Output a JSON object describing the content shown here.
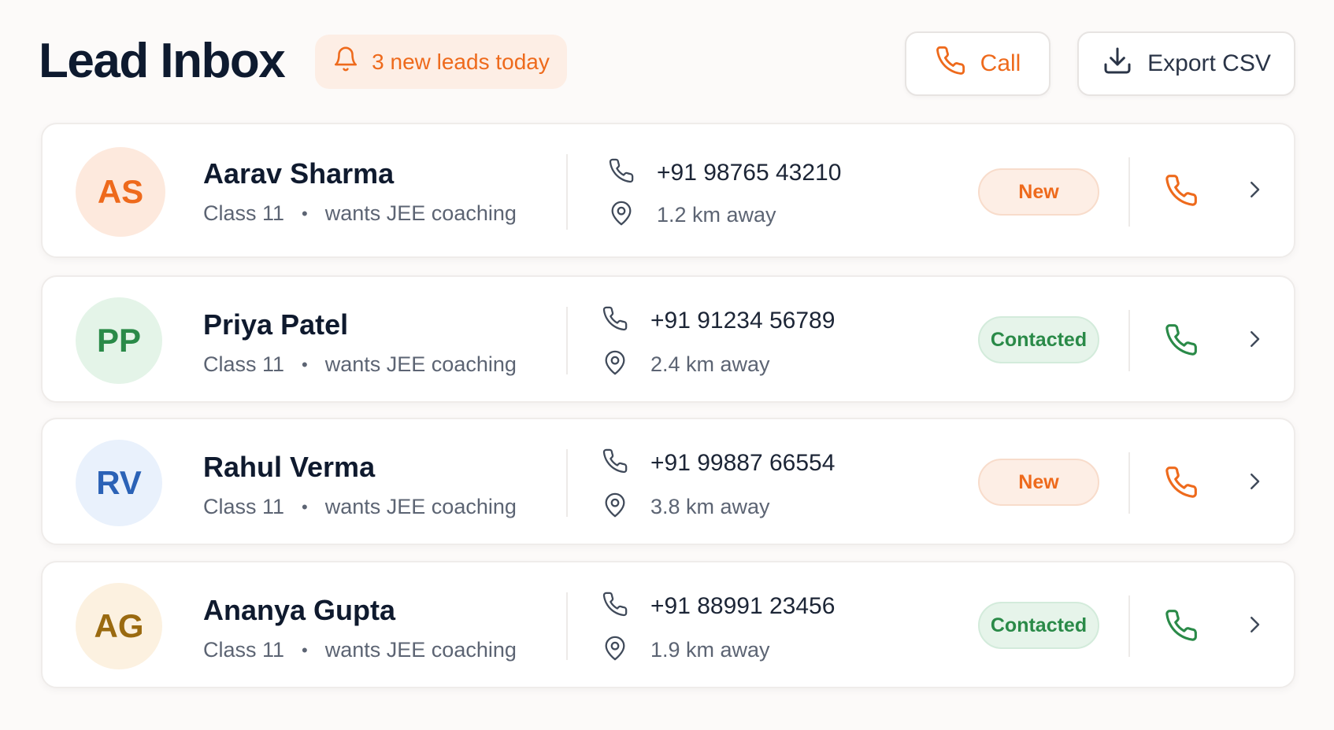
{
  "header": {
    "title": "Lead Inbox",
    "new_leads_badge": "3 new leads today",
    "call_label": "Call",
    "export_label": "Export CSV"
  },
  "colors": {
    "accent": "#ee6a1c",
    "success": "#2a8a48",
    "title": "#0e1a2f"
  },
  "leads": [
    {
      "initials": "AS",
      "name": "Aarav Sharma",
      "class": "Class 11",
      "dot": "•",
      "interest": "wants JEE coaching",
      "phone": "+91 98765 43210",
      "distance": "1.2 km away",
      "status": "New",
      "status_color": "orange",
      "avatar_bg": "#fde9dd",
      "avatar_fg": "#ee6a1c"
    },
    {
      "initials": "PP",
      "name": "Priya Patel",
      "class": "Class 11",
      "dot": "•",
      "interest": "wants JEE coaching",
      "phone": "+91 91234 56789",
      "distance": "2.4 km away",
      "status": "Contacted",
      "status_color": "green",
      "avatar_bg": "#e4f4e8",
      "avatar_fg": "#2a8a48"
    },
    {
      "initials": "RV",
      "name": "Rahul Verma",
      "class": "Class 11",
      "dot": "•",
      "interest": "wants JEE coaching",
      "phone": "+91 99887 66554",
      "distance": "3.8 km away",
      "status": "New",
      "status_color": "orange",
      "avatar_bg": "#e9f1fc",
      "avatar_fg": "#2b62b6"
    },
    {
      "initials": "AG",
      "name": "Ananya Gupta",
      "class": "Class 11",
      "dot": "•",
      "interest": "wants JEE coaching",
      "phone": "+91 88991 23456",
      "distance": "1.9 km away",
      "status": "Contacted",
      "status_color": "green",
      "avatar_bg": "#fcf1e0",
      "avatar_fg": "#9a6a10"
    }
  ],
  "icons": {
    "bell": "bell-icon",
    "call": "phone-icon",
    "export": "download-icon",
    "location": "map-pin-icon",
    "chevron": "chevron-right-icon"
  }
}
